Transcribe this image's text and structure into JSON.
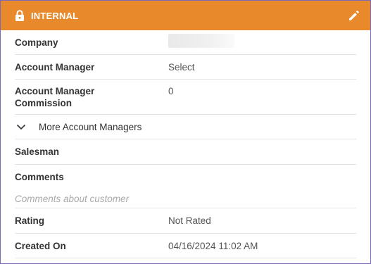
{
  "header": {
    "title": "INTERNAL",
    "lock_icon": "lock-icon",
    "edit_icon": "pencil-icon",
    "color": "#e8892c"
  },
  "fields": {
    "company": {
      "label": "Company",
      "value": ""
    },
    "account_manager": {
      "label": "Account Manager",
      "value": "Select"
    },
    "account_manager_commission": {
      "label_line1": "Account Manager",
      "label_line2": "Commission",
      "value": "0"
    },
    "more_account_managers": {
      "label": "More Account Managers",
      "icon": "chevron-down-icon"
    },
    "salesman": {
      "label": "Salesman",
      "value": ""
    },
    "comments": {
      "label": "Comments",
      "placeholder": "Comments about customer"
    },
    "rating": {
      "label": "Rating",
      "value": "Not Rated"
    },
    "created_on": {
      "label": "Created On",
      "value": "04/16/2024 11:02 AM"
    }
  }
}
